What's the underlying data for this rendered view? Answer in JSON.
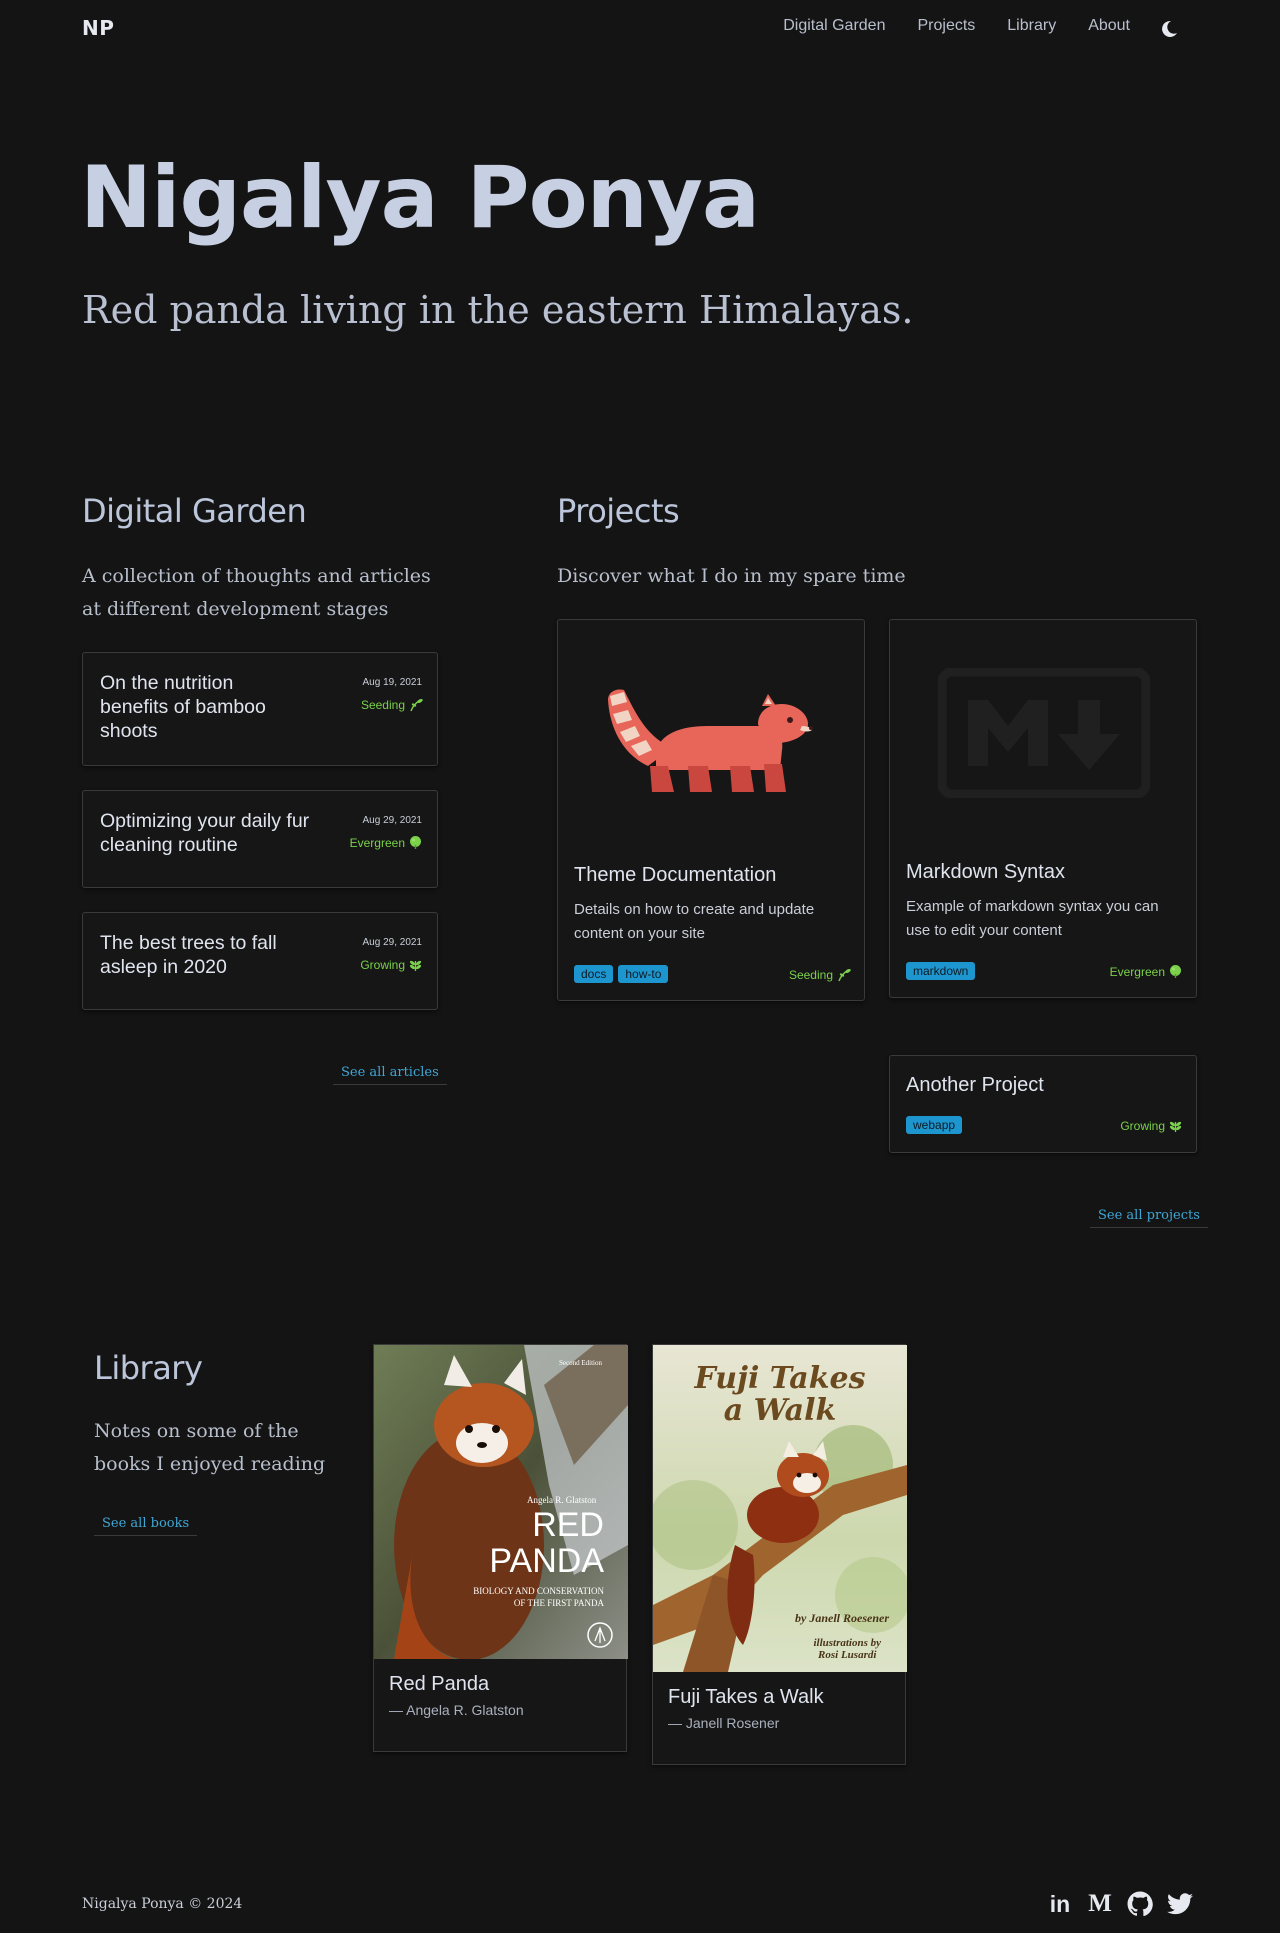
{
  "header": {
    "logo": "NP",
    "nav": [
      "Digital Garden",
      "Projects",
      "Library",
      "About"
    ],
    "theme_icon": "moon-icon"
  },
  "hero": {
    "name": "Nigalya Ponya",
    "tagline": "Red panda living in the eastern Himalayas."
  },
  "garden": {
    "title": "Digital Garden",
    "description": "A collection of thoughts and articles at different development stages",
    "articles": [
      {
        "title": "On the nutrition benefits of bamboo shoots",
        "date": "Aug 19, 2021",
        "stage": "Seeding",
        "stage_icon": "seedling-icon"
      },
      {
        "title": "Optimizing your daily fur cleaning routine",
        "date": "Aug 29, 2021",
        "stage": "Evergreen",
        "stage_icon": "evergreen-icon"
      },
      {
        "title": "The best trees to fall asleep in 2020",
        "date": "Aug 29, 2021",
        "stage": "Growing",
        "stage_icon": "growing-icon"
      }
    ],
    "see_all": "See all articles"
  },
  "projects": {
    "title": "Projects",
    "description": "Discover what I do in my spare time",
    "items": [
      {
        "title": "Theme Documentation",
        "description": "Details on how to create and update content on your site",
        "tags": [
          "docs",
          "how-to"
        ],
        "stage": "Seeding",
        "image": "red-panda-illustration"
      },
      {
        "title": "Markdown Syntax",
        "description": "Example of markdown syntax you can use to edit your content",
        "tags": [
          "markdown"
        ],
        "stage": "Evergreen",
        "image": "markdown-logo"
      },
      {
        "title": "Another Project",
        "description": "",
        "tags": [
          "webapp"
        ],
        "stage": "Growing"
      }
    ],
    "see_all": "See all projects"
  },
  "library": {
    "title": "Library",
    "description": "Notes on some of the books I enjoyed reading",
    "see_all": "See all books",
    "books": [
      {
        "title": "Red Panda",
        "author": "— Angela R. Glatston",
        "cover_edition": "Second Edition",
        "cover_author": "Angela R. Glatston",
        "cover_title_1": "RED",
        "cover_title_2": "PANDA",
        "cover_sub_1": "BIOLOGY AND CONSERVATION",
        "cover_sub_2": "OF THE FIRST PANDA"
      },
      {
        "title": "Fuji Takes a Walk",
        "author": "— Janell Rosener",
        "cover_title_1": "Fuji Takes",
        "cover_title_2": "a Walk",
        "cover_by": "by Janell Roesener",
        "cover_ill_1": "illustrations by",
        "cover_ill_2": "Rosi Lusardi"
      }
    ]
  },
  "footer": {
    "copyright": "Nigalya Ponya © 2024",
    "socials": [
      "linkedin-icon",
      "medium-icon",
      "github-icon",
      "twitter-icon"
    ],
    "linkedin": "in",
    "medium": "M"
  },
  "colors": {
    "background": "#141414",
    "heading": "#c7d0e3",
    "link": "#3fa7d6",
    "tag": "#1d96cf",
    "stage": "#7bd14a"
  }
}
